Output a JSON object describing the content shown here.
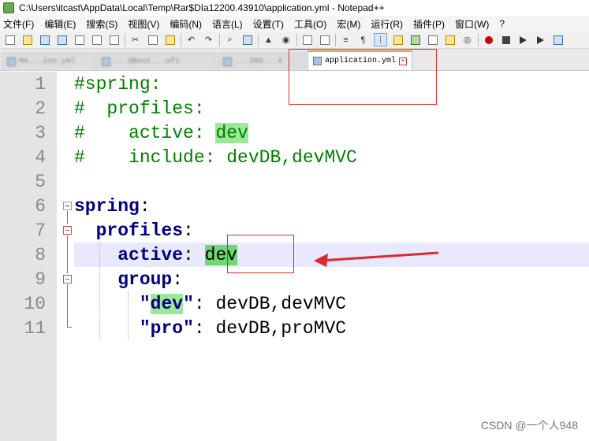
{
  "window": {
    "title": "C:\\Users\\itcast\\AppData\\Local\\Temp\\Rar$DIa12200.43910\\application.yml - Notepad++"
  },
  "menu": [
    "文件(F)",
    "编辑(E)",
    "搜索(S)",
    "视图(V)",
    "编码(N)",
    "语言(L)",
    "设置(T)",
    "工具(O)",
    "宏(M)",
    "运行(R)",
    "插件(P)",
    "窗口(W)",
    "?"
  ],
  "tabs": [
    {
      "label": "MA...ion.yml"
    },
    {
      "label": "...dBoot...ofi"
    },
    {
      "label": "...ING...4"
    },
    {
      "label": "application.yml",
      "active": true
    }
  ],
  "editor": {
    "lines": [
      {
        "n": "1",
        "text": "#spring:"
      },
      {
        "n": "2",
        "text": "#  profiles:"
      },
      {
        "n": "3",
        "pre": "#    active: ",
        "hl": "dev"
      },
      {
        "n": "4",
        "text": "#    include: devDB,devMVC"
      },
      {
        "n": "5",
        "text": ""
      },
      {
        "n": "6",
        "key": "spring",
        "rest": ":"
      },
      {
        "n": "7",
        "indent": "  ",
        "key": "profiles",
        "rest": ":"
      },
      {
        "n": "8",
        "indent": "    ",
        "key": "active",
        "rest": ": ",
        "hl": "dev"
      },
      {
        "n": "9",
        "indent": "    ",
        "key": "group",
        "rest": ":"
      },
      {
        "n": "10",
        "indent": "      ",
        "q1": "\"",
        "key": "dev",
        "q2": "\"",
        "rest": ": devDB,devMVC"
      },
      {
        "n": "11",
        "indent": "      ",
        "q1": "\"",
        "key": "pro",
        "q2": "\"",
        "rest": ": devDB,proMVC"
      }
    ]
  },
  "watermark": "CSDN @一个人948",
  "colors": {
    "comment": "#008000",
    "key": "#000080",
    "highlight": "#9be89b",
    "annotation": "#e02a2a",
    "current_line": "#e8e8ff"
  }
}
